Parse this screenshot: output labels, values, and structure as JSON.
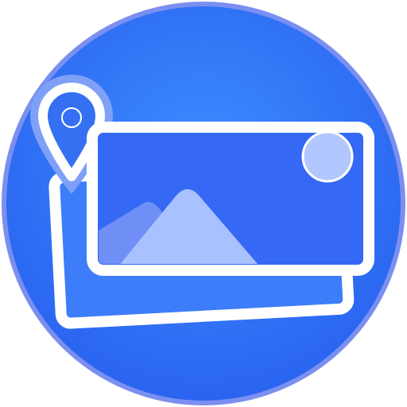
{
  "app_icon": {
    "name": "photo-location-app-icon",
    "icon_names": [
      "location-pin-icon",
      "photo-stack-icon",
      "mountain-icon",
      "sun-icon"
    ],
    "colors": {
      "ring": "#7b8ff0",
      "background_center": "#3d8dff",
      "background_edge": "#2a64f0",
      "card": "#3569f5",
      "frame": "#ffffff",
      "mountain_front": "#a9c1ff",
      "mountain_back": "#6f8ff7",
      "sun": "#b3c7ff",
      "pin_fill": "#3570f2",
      "pin_outline": "#ffffff",
      "pin_halo": "#7ea0f7"
    }
  }
}
